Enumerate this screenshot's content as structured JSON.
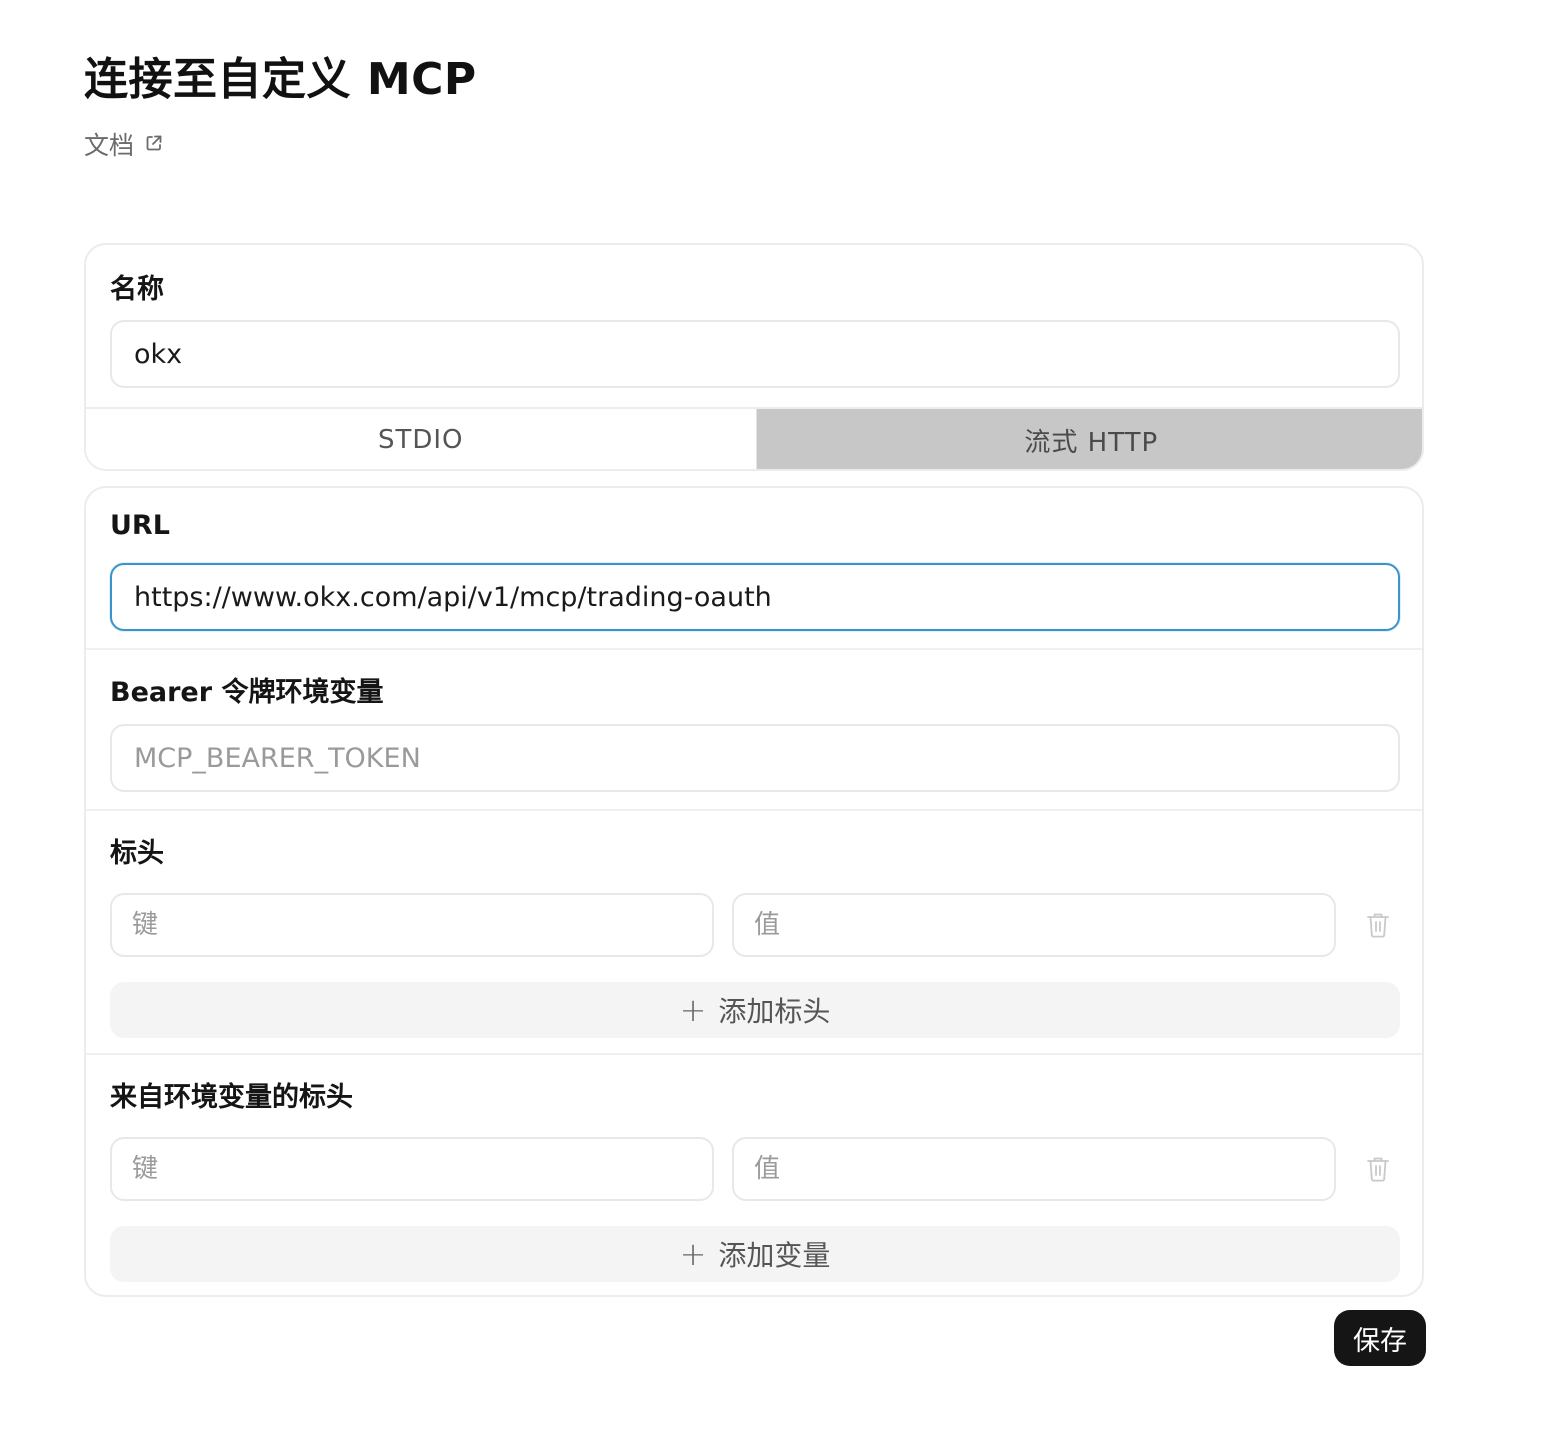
{
  "page": {
    "title": "连接至自定义 MCP",
    "docs_link": "文档"
  },
  "name_section": {
    "label": "名称",
    "value": "okx"
  },
  "transport_tabs": [
    {
      "label": "STDIO",
      "active": false
    },
    {
      "label": "流式 HTTP",
      "active": true
    }
  ],
  "url_section": {
    "label": "URL",
    "value": "https://www.okx.com/api/v1/mcp/trading-oauth"
  },
  "bearer_section": {
    "label": "Bearer 令牌环境变量",
    "placeholder": "MCP_BEARER_TOKEN"
  },
  "headers_section": {
    "label": "标头",
    "key_placeholder": "键",
    "value_placeholder": "值",
    "add_label": "添加标头"
  },
  "env_headers_section": {
    "label": "来自环境变量的标头",
    "key_placeholder": "键",
    "value_placeholder": "值",
    "add_label": "添加变量"
  },
  "actions": {
    "save_label": "保存"
  },
  "colors": {
    "focus_border": "#3b94c9",
    "active_tab_bg": "#c7c7c7",
    "save_bg": "#151515"
  },
  "icons": {
    "docs": "external-link-icon",
    "delete": "trash-icon",
    "add": "plus-icon"
  }
}
